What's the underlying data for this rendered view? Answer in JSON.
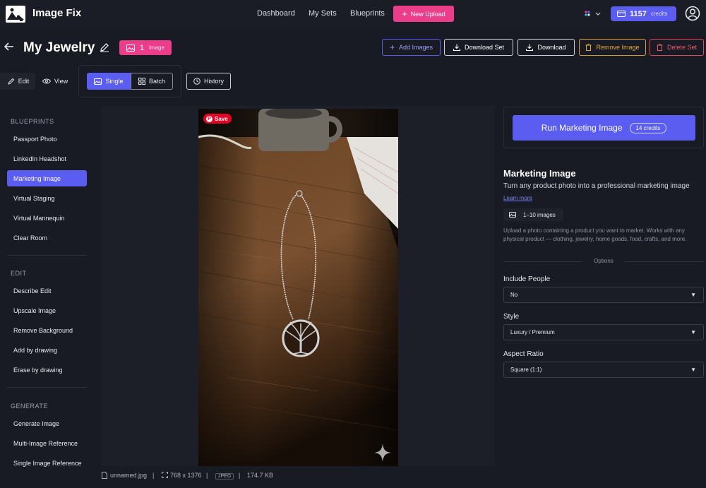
{
  "app": {
    "name": "Image Fix"
  },
  "nav": {
    "links": [
      "Dashboard",
      "My Sets",
      "Blueprints"
    ],
    "new_upload": "New Upload",
    "credits_value": "1157",
    "credits_label": "credits"
  },
  "header": {
    "title": "My Jewelry",
    "image_count": "1",
    "image_label": "image",
    "buttons": {
      "add_images": "Add Images",
      "download_set": "Download Set",
      "download": "Download",
      "remove_image": "Remove Image",
      "delete_set": "Delete Set"
    }
  },
  "modes": {
    "edit": "Edit",
    "view": "View",
    "single": "Single",
    "batch": "Batch",
    "history": "History"
  },
  "sidebar": {
    "sections": [
      {
        "title": "BLUEPRINTS",
        "items": [
          "Passport Photo",
          "LinkedIn Headshot",
          "Marketing Image",
          "Virtual Staging",
          "Virtual Mannequin",
          "Clear Room"
        ]
      },
      {
        "title": "EDIT",
        "items": [
          "Describe Edit",
          "Upscale Image",
          "Remove Background",
          "Add by drawing",
          "Erase by drawing"
        ]
      },
      {
        "title": "GENERATE",
        "items": [
          "Generate Image",
          "Multi-Image Reference",
          "Single Image Reference"
        ]
      }
    ],
    "active": "Marketing Image"
  },
  "canvas": {
    "save_label": "Save",
    "file": {
      "name": "unnamed.jpg",
      "dimensions": "768 x 1376",
      "format": "JPEG",
      "size": "174.7 KB",
      "sep": "|"
    }
  },
  "panel": {
    "run_label": "Run Marketing Image",
    "run_credits": "14 credits",
    "title": "Marketing Image",
    "subtitle": "Turn any product photo into a professional marketing image",
    "learn_more": "Learn more",
    "image_range": "1–10 images",
    "description": "Upload a photo containing a product you want to market. Works with any physical product — clothing, jewelry, home goods, food, crafts, and more.",
    "options_label": "Options",
    "fields": [
      {
        "label": "Include People",
        "value": "No"
      },
      {
        "label": "Style",
        "value": "Luxury / Premium"
      },
      {
        "label": "Aspect Ratio",
        "value": "Square (1:1)"
      }
    ]
  },
  "colors": {
    "accent": "#5b5cf0",
    "pink": "#ec3d8a",
    "warning": "#e6a83a",
    "danger": "#ef5a6c",
    "background": "#181b23"
  }
}
